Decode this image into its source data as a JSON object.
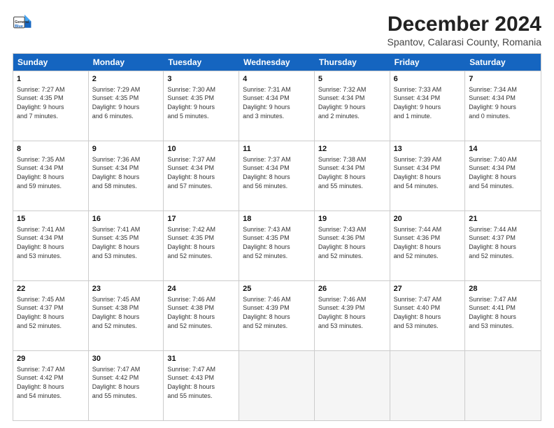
{
  "header": {
    "logo_general": "General",
    "logo_blue": "Blue",
    "title": "December 2024",
    "subtitle": "Spantov, Calarasi County, Romania"
  },
  "days": [
    "Sunday",
    "Monday",
    "Tuesday",
    "Wednesday",
    "Thursday",
    "Friday",
    "Saturday"
  ],
  "weeks": [
    [
      {
        "day": "1",
        "info": "Sunrise: 7:27 AM\nSunset: 4:35 PM\nDaylight: 9 hours\nand 7 minutes."
      },
      {
        "day": "2",
        "info": "Sunrise: 7:29 AM\nSunset: 4:35 PM\nDaylight: 9 hours\nand 6 minutes."
      },
      {
        "day": "3",
        "info": "Sunrise: 7:30 AM\nSunset: 4:35 PM\nDaylight: 9 hours\nand 5 minutes."
      },
      {
        "day": "4",
        "info": "Sunrise: 7:31 AM\nSunset: 4:34 PM\nDaylight: 9 hours\nand 3 minutes."
      },
      {
        "day": "5",
        "info": "Sunrise: 7:32 AM\nSunset: 4:34 PM\nDaylight: 9 hours\nand 2 minutes."
      },
      {
        "day": "6",
        "info": "Sunrise: 7:33 AM\nSunset: 4:34 PM\nDaylight: 9 hours\nand 1 minute."
      },
      {
        "day": "7",
        "info": "Sunrise: 7:34 AM\nSunset: 4:34 PM\nDaylight: 9 hours\nand 0 minutes."
      }
    ],
    [
      {
        "day": "8",
        "info": "Sunrise: 7:35 AM\nSunset: 4:34 PM\nDaylight: 8 hours\nand 59 minutes."
      },
      {
        "day": "9",
        "info": "Sunrise: 7:36 AM\nSunset: 4:34 PM\nDaylight: 8 hours\nand 58 minutes."
      },
      {
        "day": "10",
        "info": "Sunrise: 7:37 AM\nSunset: 4:34 PM\nDaylight: 8 hours\nand 57 minutes."
      },
      {
        "day": "11",
        "info": "Sunrise: 7:37 AM\nSunset: 4:34 PM\nDaylight: 8 hours\nand 56 minutes."
      },
      {
        "day": "12",
        "info": "Sunrise: 7:38 AM\nSunset: 4:34 PM\nDaylight: 8 hours\nand 55 minutes."
      },
      {
        "day": "13",
        "info": "Sunrise: 7:39 AM\nSunset: 4:34 PM\nDaylight: 8 hours\nand 54 minutes."
      },
      {
        "day": "14",
        "info": "Sunrise: 7:40 AM\nSunset: 4:34 PM\nDaylight: 8 hours\nand 54 minutes."
      }
    ],
    [
      {
        "day": "15",
        "info": "Sunrise: 7:41 AM\nSunset: 4:34 PM\nDaylight: 8 hours\nand 53 minutes."
      },
      {
        "day": "16",
        "info": "Sunrise: 7:41 AM\nSunset: 4:35 PM\nDaylight: 8 hours\nand 53 minutes."
      },
      {
        "day": "17",
        "info": "Sunrise: 7:42 AM\nSunset: 4:35 PM\nDaylight: 8 hours\nand 52 minutes."
      },
      {
        "day": "18",
        "info": "Sunrise: 7:43 AM\nSunset: 4:35 PM\nDaylight: 8 hours\nand 52 minutes."
      },
      {
        "day": "19",
        "info": "Sunrise: 7:43 AM\nSunset: 4:36 PM\nDaylight: 8 hours\nand 52 minutes."
      },
      {
        "day": "20",
        "info": "Sunrise: 7:44 AM\nSunset: 4:36 PM\nDaylight: 8 hours\nand 52 minutes."
      },
      {
        "day": "21",
        "info": "Sunrise: 7:44 AM\nSunset: 4:37 PM\nDaylight: 8 hours\nand 52 minutes."
      }
    ],
    [
      {
        "day": "22",
        "info": "Sunrise: 7:45 AM\nSunset: 4:37 PM\nDaylight: 8 hours\nand 52 minutes."
      },
      {
        "day": "23",
        "info": "Sunrise: 7:45 AM\nSunset: 4:38 PM\nDaylight: 8 hours\nand 52 minutes."
      },
      {
        "day": "24",
        "info": "Sunrise: 7:46 AM\nSunset: 4:38 PM\nDaylight: 8 hours\nand 52 minutes."
      },
      {
        "day": "25",
        "info": "Sunrise: 7:46 AM\nSunset: 4:39 PM\nDaylight: 8 hours\nand 52 minutes."
      },
      {
        "day": "26",
        "info": "Sunrise: 7:46 AM\nSunset: 4:39 PM\nDaylight: 8 hours\nand 53 minutes."
      },
      {
        "day": "27",
        "info": "Sunrise: 7:47 AM\nSunset: 4:40 PM\nDaylight: 8 hours\nand 53 minutes."
      },
      {
        "day": "28",
        "info": "Sunrise: 7:47 AM\nSunset: 4:41 PM\nDaylight: 8 hours\nand 53 minutes."
      }
    ],
    [
      {
        "day": "29",
        "info": "Sunrise: 7:47 AM\nSunset: 4:42 PM\nDaylight: 8 hours\nand 54 minutes."
      },
      {
        "day": "30",
        "info": "Sunrise: 7:47 AM\nSunset: 4:42 PM\nDaylight: 8 hours\nand 55 minutes."
      },
      {
        "day": "31",
        "info": "Sunrise: 7:47 AM\nSunset: 4:43 PM\nDaylight: 8 hours\nand 55 minutes."
      },
      null,
      null,
      null,
      null
    ]
  ]
}
